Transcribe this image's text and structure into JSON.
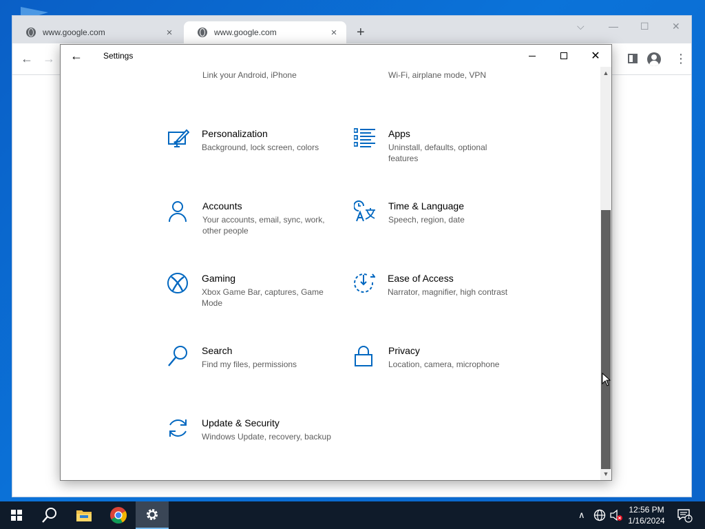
{
  "browser": {
    "tabs": [
      {
        "label": "www.google.com",
        "active": false
      },
      {
        "label": "www.google.com",
        "active": true
      }
    ],
    "new_tab": "+",
    "close_glyph": "×",
    "window_controls": {
      "dropdown": "⌵",
      "minimize": "—",
      "maximize": "☐",
      "close": "✕"
    },
    "toolbar": {
      "back": "←",
      "forward": "→",
      "menu": "⋮"
    }
  },
  "settings": {
    "title": "Settings",
    "back_glyph": "←",
    "close_glyph": "✕",
    "accent_color": "#0067c0",
    "items": [
      {
        "icon": "phone-icon",
        "name": "",
        "desc": "Link your Android, iPhone"
      },
      {
        "icon": "network-globe-icon",
        "name": "",
        "desc": "Wi-Fi, airplane mode, VPN"
      },
      {
        "icon": "personalization-icon",
        "name": "Personalization",
        "desc": "Background, lock screen, colors"
      },
      {
        "icon": "apps-icon",
        "name": "Apps",
        "desc": "Uninstall, defaults, optional features"
      },
      {
        "icon": "accounts-icon",
        "name": "Accounts",
        "desc": "Your accounts, email, sync, work, other people"
      },
      {
        "icon": "time-language-icon",
        "name": "Time & Language",
        "desc": "Speech, region, date"
      },
      {
        "icon": "xbox-icon",
        "name": "Gaming",
        "desc": "Xbox Game Bar, captures, Game Mode"
      },
      {
        "icon": "ease-of-access-icon",
        "name": "Ease of Access",
        "desc": "Narrator, magnifier, high contrast"
      },
      {
        "icon": "search-icon",
        "name": "Search",
        "desc": "Find my files, permissions"
      },
      {
        "icon": "lock-icon",
        "name": "Privacy",
        "desc": "Location, camera, microphone"
      },
      {
        "icon": "sync-icon",
        "name": "Update & Security",
        "desc": "Windows Update, recovery, backup"
      }
    ],
    "scrollbar": {
      "up": "▲",
      "down": "▼",
      "position_fraction": 0.37,
      "visible_fraction": 0.66
    }
  },
  "taskbar": {
    "apps": [
      "start-icon",
      "search-icon",
      "file-explorer-icon",
      "chrome-icon",
      "settings-gear-icon"
    ],
    "tray": {
      "chevron": "∧",
      "time": "12:56 PM",
      "date": "1/16/2024",
      "notification_count": "1"
    }
  }
}
